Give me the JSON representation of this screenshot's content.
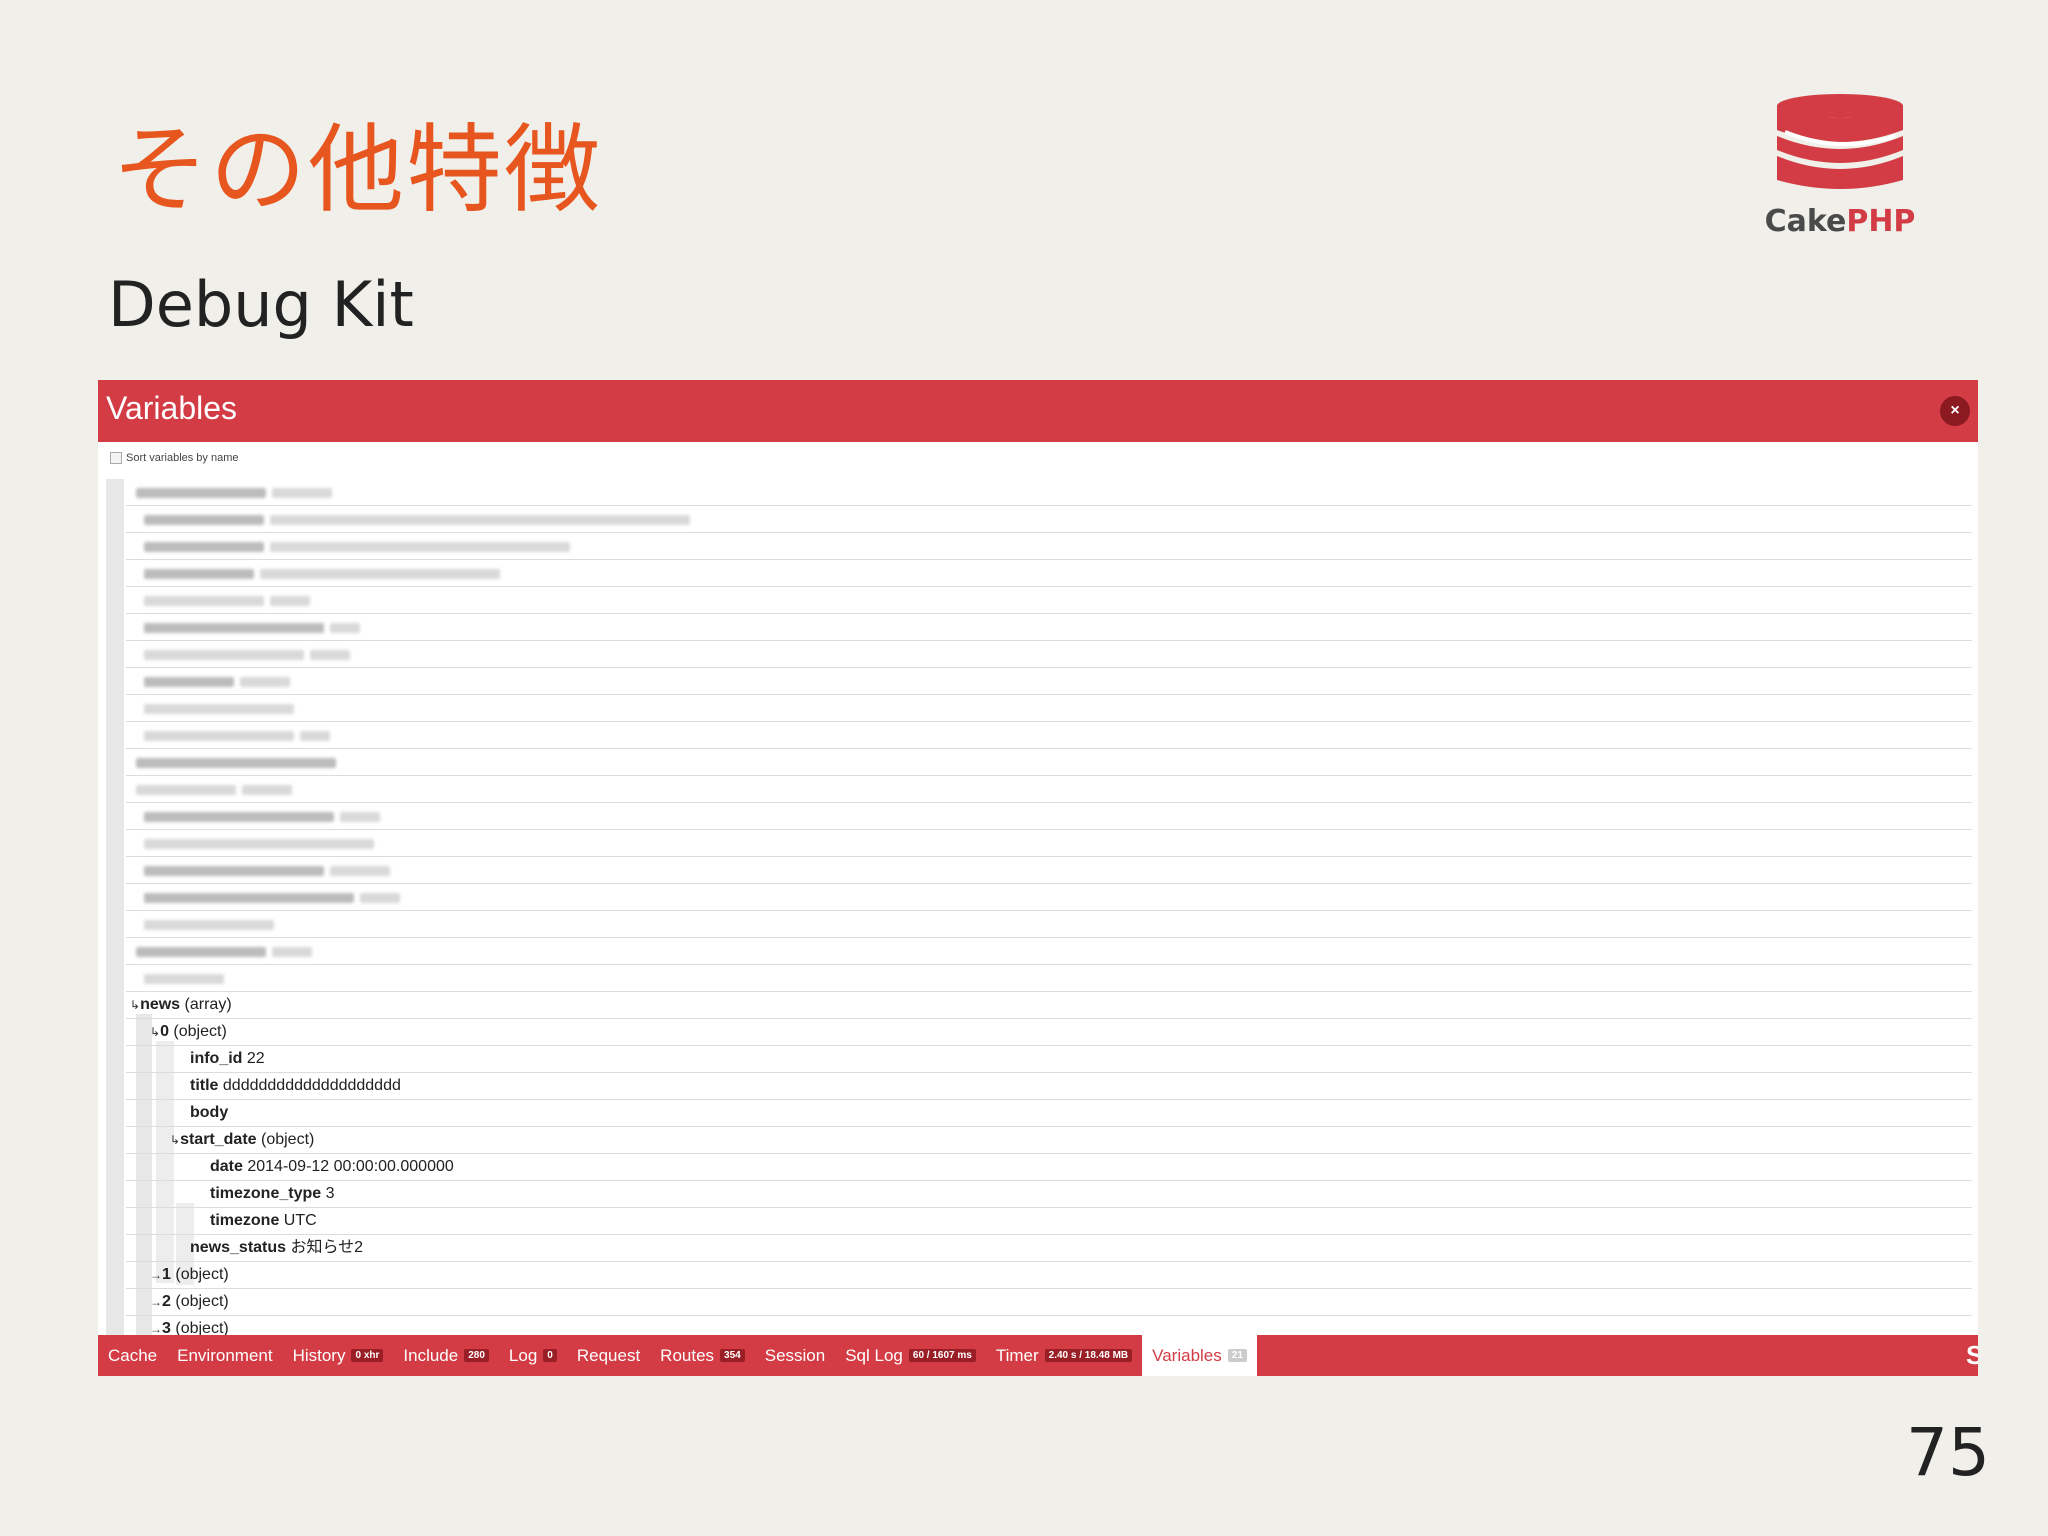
{
  "slide": {
    "title": "その他特徴",
    "subtitle": "Debug Kit",
    "page_number": "75"
  },
  "logo": {
    "text_cake": "Cake",
    "text_php": "PHP"
  },
  "panel": {
    "title": "Variables",
    "close_label": "×",
    "sort_label": "Sort variables by name"
  },
  "variables": {
    "news": {
      "key": "news",
      "type": "(array)"
    },
    "item0": {
      "key": "0",
      "type": "(object)"
    },
    "info_id": {
      "key": "info_id",
      "value": "22"
    },
    "title": {
      "key": "title",
      "value": "dddddddddddddddddddd"
    },
    "body": {
      "key": "body",
      "value": ""
    },
    "start_date": {
      "key": "start_date",
      "type": "(object)"
    },
    "date": {
      "key": "date",
      "value": "2014-09-12 00:00:00.000000"
    },
    "timezone_type": {
      "key": "timezone_type",
      "value": "3"
    },
    "timezone": {
      "key": "timezone",
      "value": "UTC"
    },
    "news_status": {
      "key": "news_status",
      "value": "お知らせ2"
    },
    "item1": {
      "key": "1",
      "type": "(object)"
    },
    "item2": {
      "key": "2",
      "type": "(object)"
    },
    "item3": {
      "key": "3",
      "type": "(object)"
    }
  },
  "toolbar": {
    "items": [
      {
        "label": "Cache",
        "badge": ""
      },
      {
        "label": "Environment",
        "badge": ""
      },
      {
        "label": "History",
        "badge": "0 xhr"
      },
      {
        "label": "Include",
        "badge": "280"
      },
      {
        "label": "Log",
        "badge": "0"
      },
      {
        "label": "Request",
        "badge": ""
      },
      {
        "label": "Routes",
        "badge": "354"
      },
      {
        "label": "Session",
        "badge": ""
      },
      {
        "label": "Sql Log",
        "badge": "60 / 1607 ms"
      },
      {
        "label": "Timer",
        "badge": "2.40 s / 18.48 MB"
      },
      {
        "label": "Variables",
        "badge": "21"
      }
    ],
    "end_label": "S"
  },
  "colors": {
    "title_orange": "#e8561f",
    "cake_red": "#d33c44",
    "slide_bg": "#f0efea"
  }
}
